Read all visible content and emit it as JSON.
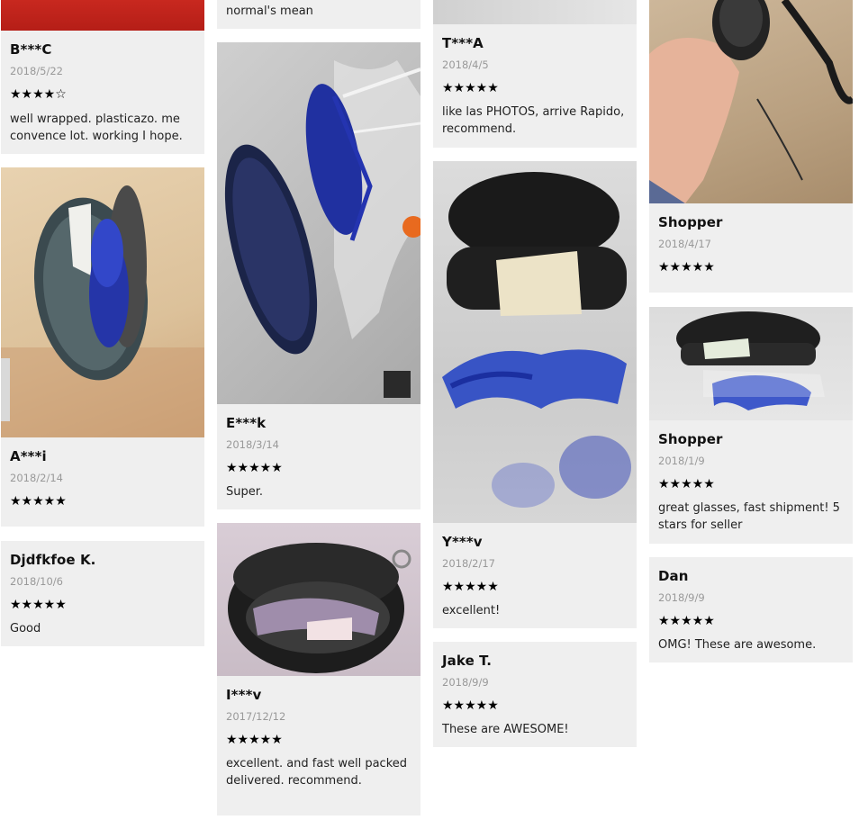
{
  "reviews": [
    {
      "name": "B***C",
      "date": "2018/5/22",
      "stars": "★★★★☆",
      "text": "well wrapped. plasticazo. me convence lot. working I hope."
    },
    {
      "name": "A***i",
      "date": "2018/2/14",
      "stars": "★★★★★",
      "text": ""
    },
    {
      "name": "Djdfkfoe K.",
      "date": "2018/10/6",
      "stars": "★★★★★",
      "text": "Good"
    },
    {
      "name": "",
      "date": "",
      "stars": "",
      "text": "normal's mean"
    },
    {
      "name": "E***k",
      "date": "2018/3/14",
      "stars": "★★★★★",
      "text": "Super."
    },
    {
      "name": "I***v",
      "date": "2017/12/12",
      "stars": "★★★★★",
      "text": "excellent. and fast well packed delivered. recommend."
    },
    {
      "name": "T***A",
      "date": "2018/4/5",
      "stars": "★★★★★",
      "text": "like las PHOTOS, arrive Rapido, recommend."
    },
    {
      "name": "Y***v",
      "date": "2018/2/17",
      "stars": "★★★★★",
      "text": "excellent!"
    },
    {
      "name": "Jake T.",
      "date": "2018/9/9",
      "stars": "★★★★★",
      "text": "These are AWESOME!"
    },
    {
      "name": "Shopper",
      "date": "2018/4/17",
      "stars": "★★★★★",
      "text": ""
    },
    {
      "name": "Shopper",
      "date": "2018/1/9",
      "stars": "★★★★★",
      "text": "great glasses, fast shipment! 5 stars for seller"
    },
    {
      "name": "Dan",
      "date": "2018/9/9",
      "stars": "★★★★★",
      "text": "OMG! These are awesome."
    }
  ]
}
